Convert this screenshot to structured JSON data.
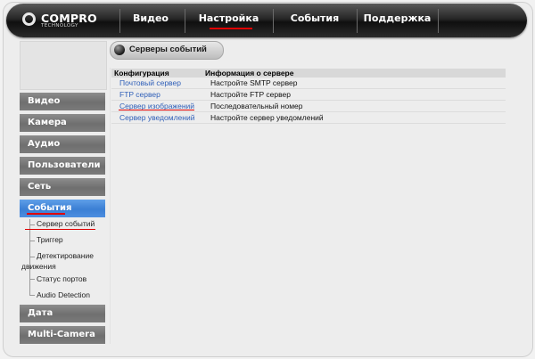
{
  "brand": {
    "name": "COMPRO",
    "sub": "TECHNOLOGY"
  },
  "topnav": [
    {
      "label": "Видео",
      "active": false
    },
    {
      "label": "Настройка",
      "active": true
    },
    {
      "label": "События",
      "active": false
    },
    {
      "label": "Поддержка",
      "active": false
    }
  ],
  "sidebar": {
    "items": [
      {
        "label": "Видео"
      },
      {
        "label": "Камера"
      },
      {
        "label": "Аудио"
      },
      {
        "label": "Пользователи"
      },
      {
        "label": "Сеть"
      },
      {
        "label": "События"
      },
      {
        "label": "Дата"
      },
      {
        "label": "Multi-Camera"
      }
    ],
    "sub_items": [
      {
        "label": "Сервер событий",
        "active": true
      },
      {
        "label": "Триггер"
      },
      {
        "label": "Детектирование"
      },
      {
        "label": "движения"
      },
      {
        "label": "Статус портов"
      },
      {
        "label": "Audio Detection"
      }
    ],
    "accent": "#3b7fd4"
  },
  "page": {
    "title": "Серверы событий"
  },
  "table": {
    "headers": [
      "Конфигурация",
      "Информация о сервере"
    ],
    "rows": [
      {
        "name": "Почтовый сервер",
        "info": "Настройте SMTP сервер"
      },
      {
        "name": "FTP сервер",
        "info": "Настройте FTP сервер"
      },
      {
        "name": "Сервер изображений",
        "info": "Последовательный номер"
      },
      {
        "name": "Сервер уведомлений",
        "info": "Настройте сервер уведомлений"
      }
    ]
  },
  "colors": {
    "link": "#2f5fb8",
    "highlight": "#e00000"
  }
}
